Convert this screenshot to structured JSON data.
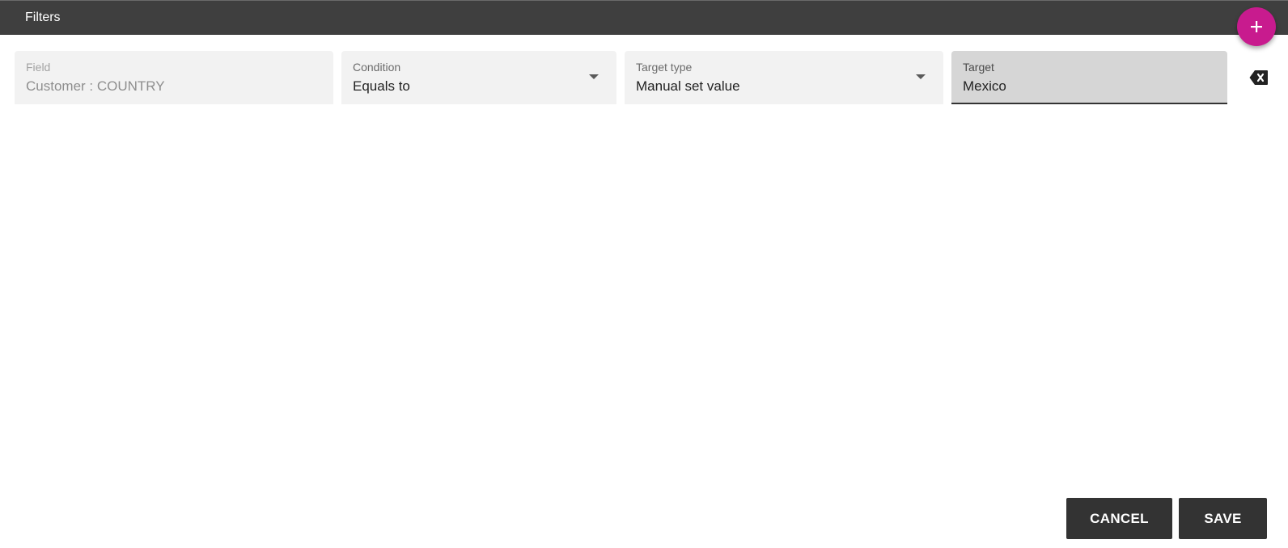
{
  "header": {
    "title": "Filters"
  },
  "fab": {
    "icon": "plus-icon",
    "color": "#c81b8e"
  },
  "filter": {
    "field": {
      "label": "Field",
      "value": "Customer : COUNTRY"
    },
    "condition": {
      "label": "Condition",
      "value": "Equals to"
    },
    "target_type": {
      "label": "Target type",
      "value": "Manual set value"
    },
    "target": {
      "label": "Target",
      "value": "Mexico"
    },
    "clear_icon": "backspace-icon"
  },
  "actions": {
    "cancel_label": "CANCEL",
    "save_label": "SAVE"
  },
  "colors": {
    "header_bg": "#3f3f3f",
    "button_bg": "#333333",
    "accent": "#c81b8e"
  }
}
